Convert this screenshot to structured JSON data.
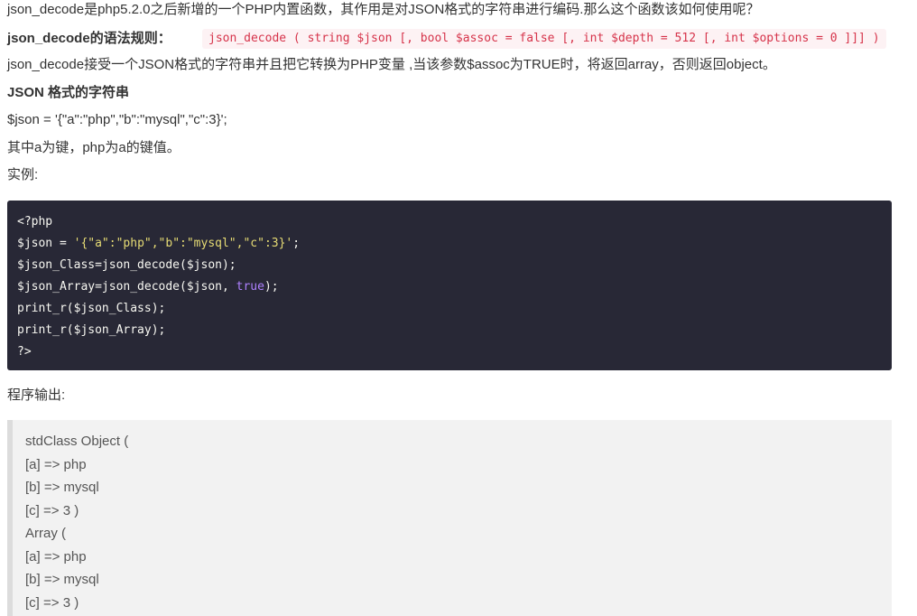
{
  "intro": "json_decode是php5.2.0之后新增的一个PHP内置函数，其作用是对JSON格式的字符串进行编码.那么这个函数该如何使用呢？",
  "syntax": {
    "label": "json_decode的语法规则：",
    "code": "json_decode ( string $json [, bool $assoc = false [, int $depth = 512 [, int $options = 0 ]]] )"
  },
  "description": "json_decode接受一个JSON格式的字符串并且把它转换为PHP变量 ,当该参数$assoc为TRUE时，将返回array，否则返回object。",
  "json_heading": "JSON 格式的字符串",
  "json_example": "$json = '{\"a\":\"php\",\"b\":\"mysql\",\"c\":3}';",
  "key_note": "其中a为键，php为a的键值。",
  "example_label": "实例:",
  "code_block": {
    "line1": "<?php",
    "line2_prefix": "$json = ",
    "line2_string": "'{\"a\":\"php\",\"b\":\"mysql\",\"c\":3}'",
    "line2_suffix": ";",
    "line3": "$json_Class=json_decode($json);",
    "line4_prefix": "$json_Array=json_decode($json, ",
    "line4_keyword": "true",
    "line4_suffix": ");",
    "line5": "print_r($json_Class);",
    "line6": "print_r($json_Array);",
    "line7": "?>"
  },
  "output_label": "程序输出:",
  "output_lines": [
    "stdClass Object (",
    "[a] => php",
    "[b] => mysql",
    "[c] => 3 )",
    "Array (",
    "[a] => php",
    "[b] => mysql",
    "[c] => 3 )"
  ],
  "colors": {
    "code_bg": "#282836",
    "string": "#e6db74",
    "keyword": "#ae81ff",
    "inline_code_text": "#d6334a",
    "quote_bg": "#f2f2f2"
  }
}
